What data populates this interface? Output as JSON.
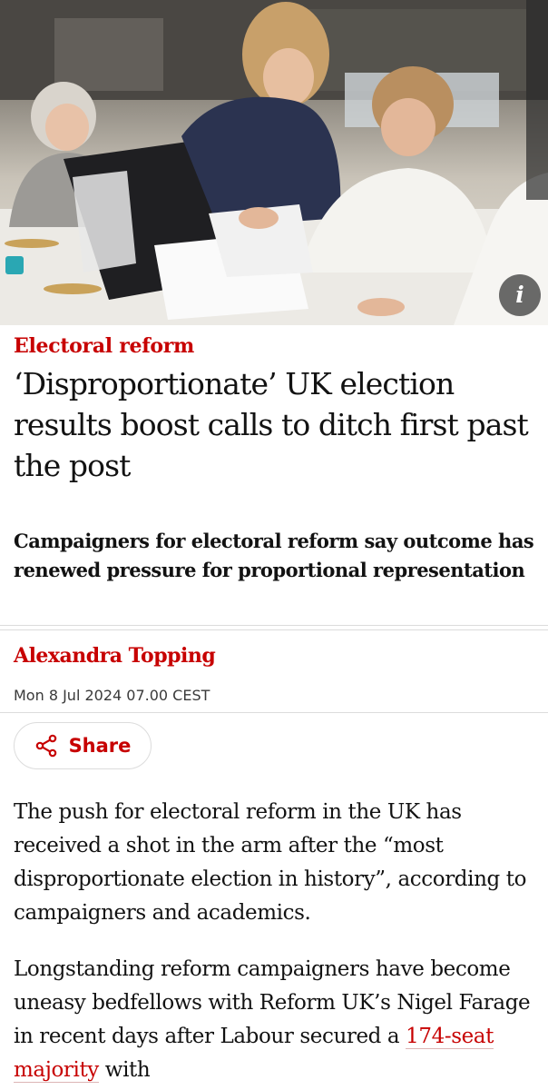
{
  "hero": {
    "info_icon": "info-icon",
    "info_glyph": "i"
  },
  "article": {
    "kicker": "Electoral reform",
    "headline": "‘Disproportionate’ UK election results boost calls to ditch first past the post",
    "standfirst": "Campaigners for electoral reform say outcome has renewed pressure for proportional representation",
    "byline": "Alexandra Topping",
    "date": "Mon 8 Jul 2024 07.00 CEST",
    "share_label": "Share",
    "share_icon": "share-icon",
    "body": {
      "p1": "The push for electoral reform in the UK has received a shot in the arm after the “most disproportionate election in history”, according to campaigners and academics.",
      "p2_before": "Longstanding reform campaigners have become uneasy bedfellows with Reform UK’s Nigel Farage in recent days after Labour secured a ",
      "p2_link": "174-seat majority",
      "p2_after": " with"
    }
  },
  "colors": {
    "accent": "#c70000",
    "text": "#121212",
    "rule": "#dcdcdc"
  }
}
